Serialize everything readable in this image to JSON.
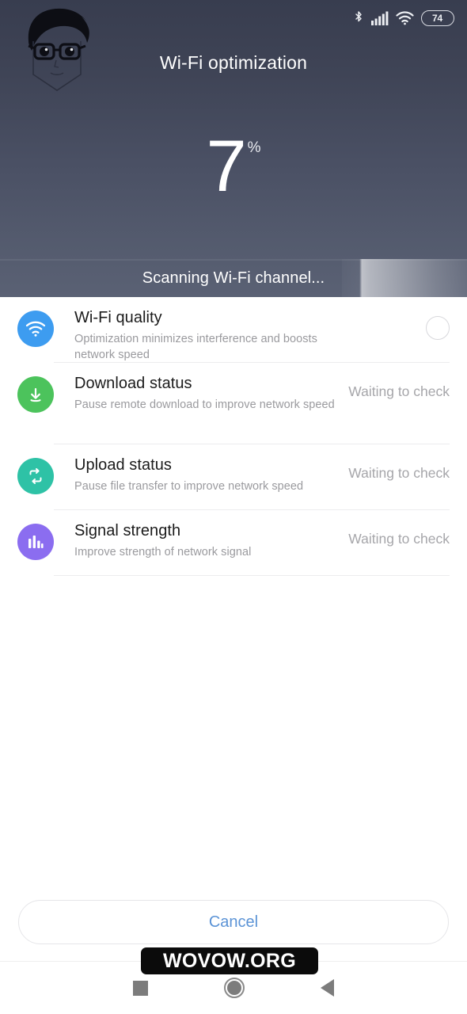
{
  "statusbar": {
    "bluetooth_icon": "bluetooth-icon",
    "signal_icon": "cellular-signal-icon",
    "wifi_icon": "wifi-icon",
    "battery_level": "74"
  },
  "header": {
    "title": "Wi-Fi optimization",
    "percent_value": "7",
    "percent_sign": "%",
    "progress_percent": 7,
    "scan_status": "Scanning Wi-Fi channel...",
    "avatar_icon": "avatar-face-watermark",
    "gradient_top": "#383d4f",
    "gradient_bottom": "#5a6174"
  },
  "list": {
    "items": [
      {
        "id": "wifi-quality",
        "icon": "wifi-icon",
        "icon_color": "#3d9cf0",
        "title": "Wi-Fi quality",
        "subtitle": "Optimization minimizes interference and boosts network speed",
        "status": "",
        "has_spinner": true
      },
      {
        "id": "download-status",
        "icon": "download-arrow-icon",
        "icon_color": "#4cc35c",
        "title": "Download status",
        "subtitle": "Pause remote download to improve network speed",
        "status": "Waiting to check",
        "has_spinner": false
      },
      {
        "id": "upload-status",
        "icon": "repeat-loop-icon",
        "icon_color": "#2ec2a6",
        "title": "Upload status",
        "subtitle": "Pause file transfer to improve network speed",
        "status": "Waiting to check",
        "has_spinner": false
      },
      {
        "id": "signal-strength",
        "icon": "signal-bars-icon",
        "icon_color": "#8b6df0",
        "title": "Signal strength",
        "subtitle": "Improve strength of network signal",
        "status": "Waiting to check",
        "has_spinner": false
      }
    ]
  },
  "footer": {
    "cancel_label": "Cancel",
    "cancel_color": "#5b93d6"
  },
  "watermark": {
    "text": "WOVOW.ORG"
  },
  "navbar": {
    "recent_icon": "recent-apps-icon",
    "home_icon": "home-icon",
    "back_icon": "back-icon"
  }
}
